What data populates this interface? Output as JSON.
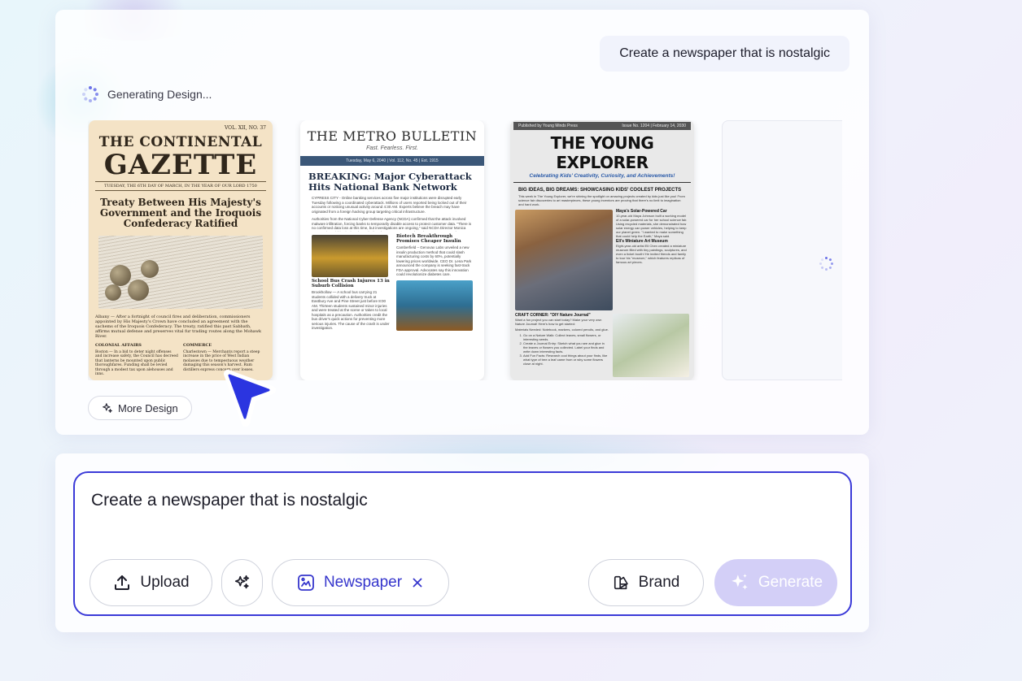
{
  "prompt_bubble": "Create a newspaper that is nostalgic",
  "status": "Generating Design...",
  "designs": [
    {
      "volume": "VOL. XII, NO. 37",
      "title_line1": "THE CONTINENTAL",
      "title_line2": "GAZETTE",
      "date": "TUESDAY, THE 6TH DAY OF MARCH, IN THE YEAR OF OUR LORD 1750",
      "headline": "Treaty Between His Majesty's Government and the Iroquois Confederacy Ratified",
      "body": "Albany — After a fortnight of council fires and deliberation, commissioners appointed by His Majesty's Crown have concluded an agreement with the sachems of the Iroquois Confederacy. The treaty, ratified this past Sabbath, affirms mutual defense and preserves vital fur trading routes along the Mohawk River.",
      "col1_title": "COLONIAL AFFAIRS",
      "col1_text": "Boston — In a bid to deter night offenses and increase safety, the Council has decreed that lanterns be mounted upon public thoroughfares. Funding shall be levied through a modest tax upon alehouses and inns.",
      "col2_title": "COMMERCE",
      "col2_text": "Charlestown — Merchants report a steep increase in the price of West Indian molasses due to tempestuous weather damaging this season's harvest. Rum distillers express concern over losses."
    },
    {
      "title": "THE METRO BULLETIN",
      "tagline": "Fast. Fearless. First.",
      "dateline": "Tuesday, May 6, 2040 | Vol. 112, No. 45 | Est. 1915",
      "headline": "BREAKING: Major Cyberattack Hits National Bank Network",
      "body1": "CYPRESS CITY - Online banking services across five major institutions were disrupted early Tuesday following a coordinated cyberattack. Millions of users reported being locked out of their accounts or noticing unusual activity around 4:30 AM. Experts believe the breach may have originated from a foreign hacking group targeting critical infrastructure.",
      "body2": "Authorities from the National Cyber Defense Agency (NCDA) confirmed that the attack involved malware infiltration, forcing banks to temporarily disable access to protect customer data. \"There is no confirmed data loss at this time, but investigations are ongoing,\" said NCDA Director Monica Reyes. Financial institutions have deployed emergency protocols and expect systems to be restored within 24 hours. Customers are advised to monitor their accounts closely and report any suspicious transactions.",
      "story2_title": "Biotech Breakthrough Promises Cheaper Insulin",
      "story2_text": "Camberfield – Genovax Labs unveiled a new insulin production method that could slash manufacturing costs by 60%, potentially lowering prices worldwide. CEO Dr. Lena Park announced the company is seeking fast-track FDA approval. Advocates say this innovation could revolutionize diabetes care.",
      "story3_title": "School Bus Crash Injures 13 in Suburb Collision",
      "story3_text": "Brookhollow — A school bus carrying 21 students collided with a delivery truck at Eastbury Ave and Pine Street just before 8:00 AM. Thirteen students sustained minor injuries and were treated at the scene or taken to local hospitals as a precaution. Authorities credit the bus driver's quick actions for preventing more serious injuries. The cause of the crash is under investigation."
    },
    {
      "publisher": "Published by Young Minds Press",
      "issue": "Issue No. 1204 | February 14, 2030",
      "title": "THE YOUNG EXPLORER",
      "subtitle": "Celebrating Kids' Creativity, Curiosity, and Achievements!",
      "section": "BIG IDEAS, BIG DREAMS: SHOWCASING KIDS' COOLEST PROJECTS",
      "intro": "This week in The Young Explorer, we're shining the spotlight on amazing projects created by kids just like you! From science fair discoveries to art masterpieces, these young inventors are proving that there's no limit to imagination and hard work.",
      "side1_title": "Maya's Solar-Powered Car",
      "side1_text": "10-year-old Maya Johnson built a working model of a solar-powered car for her school science fair. Using recycled materials, she demonstrated how solar energy can power vehicles, helping to keep our planet green. \"I wanted to make something that could help the Earth,\" Maya said.",
      "side2_title": "Eli's Miniature Art Museum",
      "side2_text": "Eight-year-old artist Eli Chen created a miniature museum filled with tiny paintings, sculptures, and even a ticket booth! He invited friends and family to tour his \"museum,\" which features replicas of famous art pieces.",
      "craft_title": "CRAFT CORNER: \"DIY Nature Journal\"",
      "craft_intro": "Want a fun project you can start today? Make your very own Nature Journal! Here's how to get started:",
      "craft_materials": "Materials Needed: Notebook, markers, colored pencils, and glue.",
      "craft_steps": [
        "Go on a Nature Walk: Collect leaves, small flowers, or interesting seeds.",
        "Create a Journal Entry: Sketch what you see and glue in the leaves or flowers you collected. Label your finds and write down interesting facts.",
        "Add Fun Facts: Research cool things about your finds, like what type of tree a leaf came from or why some flowers close at night."
      ]
    }
  ],
  "more_design_label": "More Design",
  "input": {
    "value": "Create a newspaper that is nostalgic"
  },
  "buttons": {
    "upload": "Upload",
    "newspaper_tag": "Newspaper",
    "brand": "Brand",
    "generate": "Generate"
  },
  "colors": {
    "accent": "#3b3ad8",
    "tag_text": "#3535cc",
    "generate_disabled": "#d3cff7",
    "spinner": "#6b72e8"
  },
  "icons": [
    "spinner-icon",
    "sparkle-icon",
    "upload-icon",
    "magic-wand-icon",
    "newspaper-icon",
    "close-icon",
    "brand-icon",
    "cursor-arrow-icon"
  ]
}
